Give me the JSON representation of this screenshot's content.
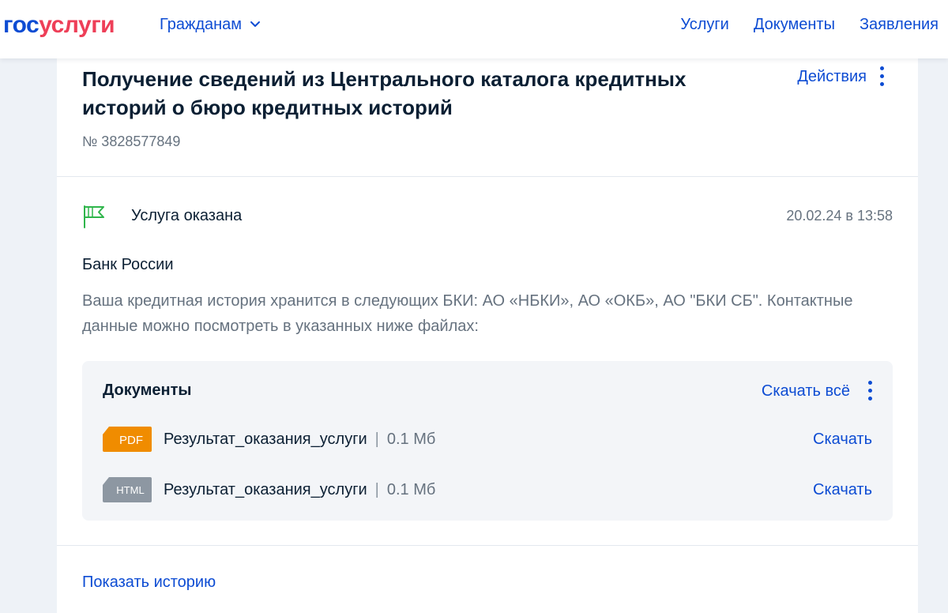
{
  "header": {
    "logo_part1": "гос",
    "logo_part2": "услуги",
    "citizens_label": "Гражданам",
    "nav": [
      "Услуги",
      "Документы",
      "Заявления"
    ]
  },
  "application": {
    "title": "Получение сведений из Центрального каталога кредитных историй о бюро кредитных историй",
    "actions_label": "Действия",
    "number": "№ 3828577849"
  },
  "status": {
    "text": "Услуга оказана",
    "date": "20.02.24 в 13:58",
    "icon": "flag-icon"
  },
  "organization": "Банк России",
  "message": "Ваша кредитная история хранится в следующих БКИ: АО «НБКИ», АО «ОКБ», АО \"БКИ СБ\". Контактные данные можно посмотреть в указанных ниже файлах:",
  "documents": {
    "title": "Документы",
    "download_all_label": "Скачать всё",
    "items": [
      {
        "type": "PDF",
        "name": "Результат_оказания_услуги",
        "separator": "|",
        "size": "0.1 Мб",
        "download_label": "Скачать",
        "badge_color": "#f08c00"
      },
      {
        "type": "HTML",
        "name": "Результат_оказания_услуги",
        "separator": "|",
        "size": "0.1 Мб",
        "download_label": "Скачать",
        "badge_color": "#8d97a2"
      }
    ]
  },
  "history_label": "Показать историю",
  "colors": {
    "accent": "#0d4cd3",
    "logo_red": "#ee3f58",
    "success": "#2fb54b",
    "background": "#eef2f7"
  }
}
